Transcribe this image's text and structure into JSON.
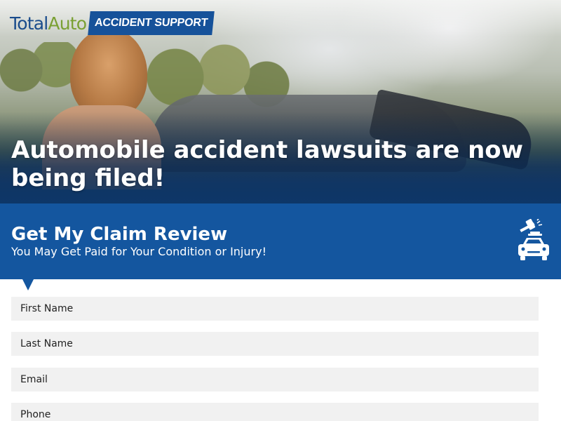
{
  "logo": {
    "total": "Total",
    "auto": "Auto",
    "badge": "ACCIDENT SUPPORT"
  },
  "hero": {
    "headline": "Automobile accident lawsuits are now being filed!"
  },
  "banner": {
    "title": "Get My Claim Review",
    "subtitle": "You May Get Paid for Your Condition or Injury!",
    "icon": "gavel-car-icon"
  },
  "form": {
    "fields": [
      {
        "placeholder": "First Name"
      },
      {
        "placeholder": "Last Name"
      },
      {
        "placeholder": "Email"
      },
      {
        "placeholder": "Phone"
      }
    ]
  },
  "colors": {
    "brand_blue": "#14569f",
    "logo_blue": "#1a4c8c",
    "logo_green": "#7aa033",
    "field_bg": "#f1f1f1"
  }
}
